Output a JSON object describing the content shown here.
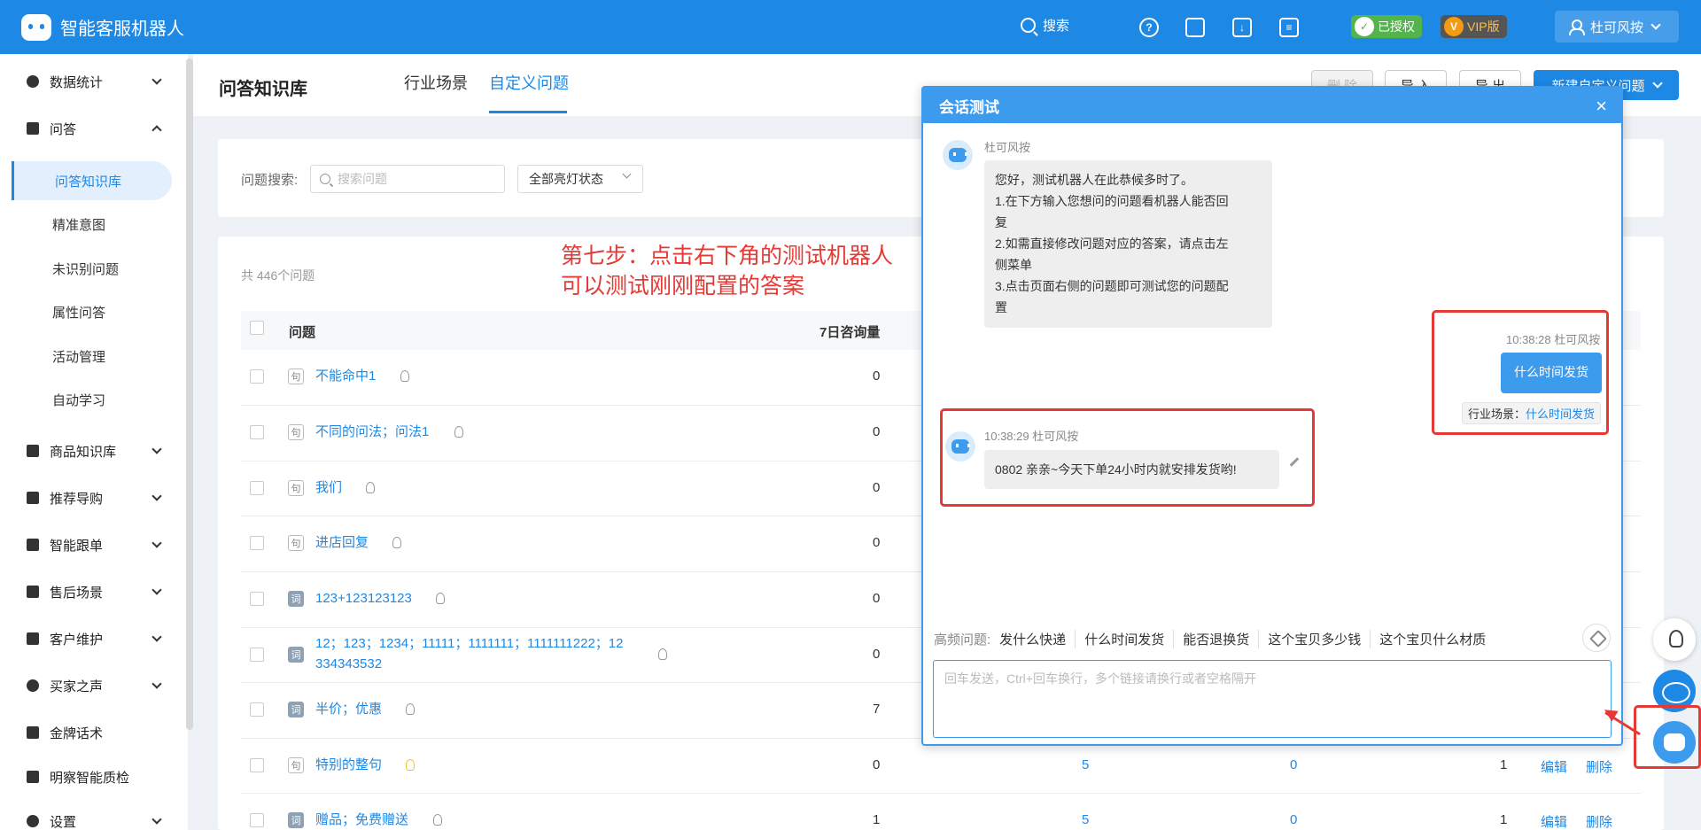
{
  "app": {
    "title": "智能客服机器人"
  },
  "topbar": {
    "search_label": "搜索",
    "authorized_label": "已授权",
    "vip_label": "VIP版",
    "user_name": "杜可风按"
  },
  "sidebar": {
    "items": [
      {
        "label": "数据统计"
      },
      {
        "label": "问答"
      },
      {
        "label": "商品知识库"
      },
      {
        "label": "推荐导购"
      },
      {
        "label": "智能跟单"
      },
      {
        "label": "售后场景"
      },
      {
        "label": "客户维护"
      },
      {
        "label": "买家之声"
      },
      {
        "label": "金牌话术"
      },
      {
        "label": "明察智能质检"
      },
      {
        "label": "设置"
      }
    ],
    "sub_items": [
      {
        "label": "问答知识库"
      },
      {
        "label": "精准意图"
      },
      {
        "label": "未识别问题"
      },
      {
        "label": "属性问答"
      },
      {
        "label": "活动管理"
      },
      {
        "label": "自动学习"
      }
    ]
  },
  "header": {
    "page_title": "问答知识库",
    "tabs": [
      {
        "label": "行业场景"
      },
      {
        "label": "自定义问题"
      }
    ],
    "buttons": {
      "delete": "删 除",
      "import": "导 入",
      "export": "导 出",
      "new": "新建自定义问题"
    }
  },
  "filter": {
    "search_label": "问题搜索:",
    "search_placeholder": "搜索问题",
    "status_select": "全部亮灯状态"
  },
  "table": {
    "total": "共 446个问题",
    "headers": {
      "question": "问题",
      "consult_7d": "7日咨询量"
    },
    "rows": [
      {
        "tag": "句",
        "question": "不能命中1",
        "consult": "0"
      },
      {
        "tag": "句",
        "question": "不同的问法；问法1",
        "consult": "0"
      },
      {
        "tag": "句",
        "question": "我们",
        "consult": "0"
      },
      {
        "tag": "句",
        "question": "进店回复",
        "consult": "0"
      },
      {
        "tag": "词",
        "question": "123+123123123",
        "consult": "0"
      },
      {
        "tag": "词",
        "question_line1": "12；123；1234；11111；1111111；1111111222；12",
        "question_line2": "334343532",
        "consult": "0"
      },
      {
        "tag": "词",
        "question": "半价；优惠",
        "consult": "7"
      },
      {
        "tag": "句",
        "question": "特别的整句",
        "consult": "0",
        "col3": "5",
        "col4": "0",
        "col5": "1",
        "edit": "编辑",
        "delete": "删除"
      },
      {
        "tag": "词",
        "question": "赠品；免费赠送",
        "consult": "1",
        "col3": "5",
        "col4": "0",
        "col5": "1",
        "edit": "编辑",
        "delete": "删除"
      }
    ]
  },
  "annotation": {
    "line1": "第七步：点击右下角的测试机器人",
    "line2": "可以测试刚刚配置的答案"
  },
  "chat": {
    "title": "会话测试",
    "close": "×",
    "welcome": {
      "sender": "杜可风按",
      "lines": [
        "您好，测试机器人在此恭候多时了。",
        "1.在下方输入您想问的问题看机器人能否回",
        "复",
        "2.如需直接修改问题对应的答案，请点击左",
        "侧菜单",
        "3.点击页面右侧的问题即可测试您的问题配",
        "置"
      ]
    },
    "user_msg": {
      "meta": "10:38:28 杜可风按",
      "text": "什么时间发货",
      "scene_label": "行业场景：",
      "scene_value": "什么时间发货"
    },
    "bot_reply": {
      "meta": "10:38:29 杜可风按",
      "text": "0802 亲亲~今天下单24小时内就安排发货哟!"
    },
    "faq_label": "高频问题:",
    "faq": [
      "发什么快递",
      "什么时间发货",
      "能否退换货",
      "这个宝贝多少钱",
      "这个宝贝什么材质"
    ],
    "input_placeholder": "回车发送，Ctrl+回车换行，多个链接请换行或者空格隔开"
  }
}
